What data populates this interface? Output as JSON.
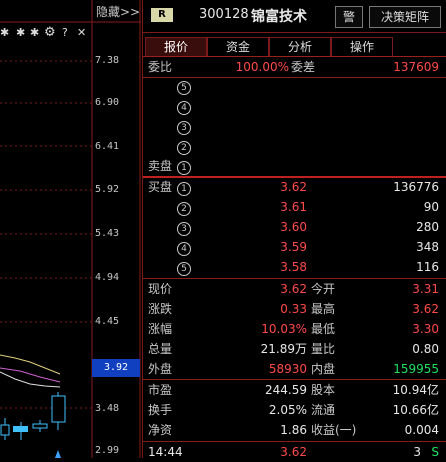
{
  "chart": {
    "hide_label": "隐藏>>",
    "toolbar_glyphs": [
      "✱",
      "✱",
      "✱"
    ],
    "toolbar_icons": [
      "gear-icon",
      "help-icon",
      "close-icon"
    ],
    "help_glyph": "?",
    "close_glyph": "✕",
    "y_ticks": [
      "7.38",
      "6.90",
      "6.41",
      "5.92",
      "5.43",
      "4.94",
      "4.45",
      "3.48",
      "2.99"
    ],
    "current_price_tag": "3.92"
  },
  "header": {
    "badge": "R",
    "code": "300128",
    "name": "锦富技术",
    "alert_button": "警",
    "decision_button": "决策矩阵"
  },
  "tabs": [
    "报价",
    "资金",
    "分析",
    "操作"
  ],
  "committee": {
    "ratio_label": "委比",
    "ratio_value": "100.00%",
    "diff_label": "委差",
    "diff_value": "137609"
  },
  "sell_orders": [
    {
      "label": "",
      "level": "5",
      "price": "",
      "volume": ""
    },
    {
      "label": "",
      "level": "4",
      "price": "",
      "volume": ""
    },
    {
      "label": "",
      "level": "3",
      "price": "",
      "volume": ""
    },
    {
      "label": "",
      "level": "2",
      "price": "",
      "volume": ""
    },
    {
      "label": "卖盘",
      "level": "1",
      "price": "",
      "volume": ""
    }
  ],
  "buy_orders": [
    {
      "label": "买盘",
      "level": "1",
      "price": "3.62",
      "volume": "136776"
    },
    {
      "label": "",
      "level": "2",
      "price": "3.61",
      "volume": "90"
    },
    {
      "label": "",
      "level": "3",
      "price": "3.60",
      "volume": "280"
    },
    {
      "label": "",
      "level": "4",
      "price": "3.59",
      "volume": "348"
    },
    {
      "label": "",
      "level": "5",
      "price": "3.58",
      "volume": "116"
    }
  ],
  "stats": [
    {
      "l1": "现价",
      "v1": "3.62",
      "c1": "red",
      "l2": "今开",
      "v2": "3.31",
      "c2": "red"
    },
    {
      "l1": "涨跌",
      "v1": "0.33",
      "c1": "red",
      "l2": "最高",
      "v2": "3.62",
      "c2": "red"
    },
    {
      "l1": "涨幅",
      "v1": "10.03%",
      "c1": "red",
      "l2": "最低",
      "v2": "3.30",
      "c2": "red"
    },
    {
      "l1": "总量",
      "v1": "21.89万",
      "c1": "white",
      "l2": "量比",
      "v2": "0.80",
      "c2": "white"
    },
    {
      "l1": "外盘",
      "v1": "58930",
      "c1": "red",
      "l2": "内盘",
      "v2": "159955",
      "c2": "green"
    }
  ],
  "fundamentals": [
    {
      "l1": "市盈",
      "v1": "244.59",
      "l2": "股本",
      "v2": "10.94亿"
    },
    {
      "l1": "换手",
      "v1": "2.05%",
      "l2": "流通",
      "v2": "10.66亿"
    },
    {
      "l1": "净资",
      "v1": "1.86",
      "l2": "收益(一)",
      "v2": "0.004"
    }
  ],
  "tick": {
    "time": "14:44",
    "price": "3.62",
    "volume": "3",
    "direction": "S"
  }
}
